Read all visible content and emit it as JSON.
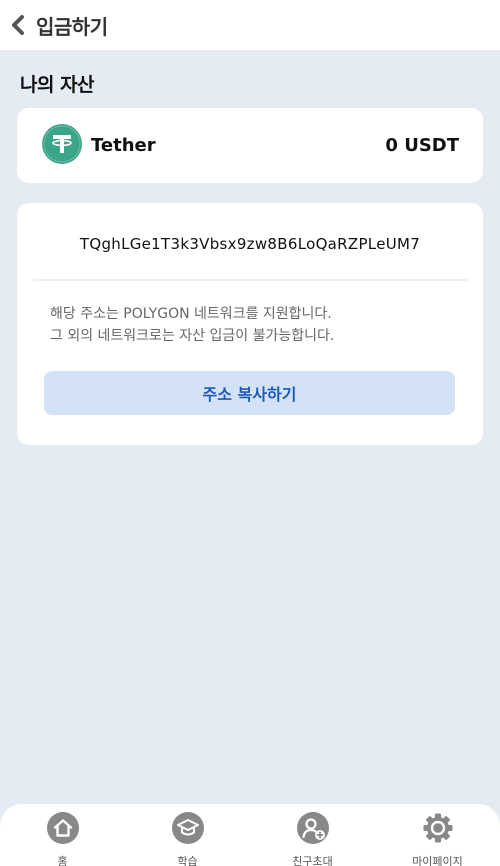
{
  "header": {
    "title": "입금하기"
  },
  "assets": {
    "section_title": "나의 자산",
    "coin_name": "Tether",
    "coin_balance": "0 USDT"
  },
  "deposit": {
    "address": "TQghLGe1T3k3Vbsx9zw8B6LoQaRZPLeUM7",
    "notice_line1": "해당 주소는 POLYGON 네트워크를 지원합니다.",
    "notice_line2": "그 외의 네트워크로는 자산 입금이 불가능합니다.",
    "copy_label": "주소 복사하기"
  },
  "colors": {
    "tether": "#3aa58a",
    "accent": "#1f5bb0",
    "button_bg": "#d4e2f8",
    "nav_icon": "#888888"
  },
  "nav": {
    "items": [
      {
        "label": "홈",
        "icon": "home-icon"
      },
      {
        "label": "학습",
        "icon": "graduation-cap-icon"
      },
      {
        "label": "친구초대",
        "icon": "add-friend-icon"
      },
      {
        "label": "마이페이지",
        "icon": "gear-icon"
      }
    ]
  }
}
